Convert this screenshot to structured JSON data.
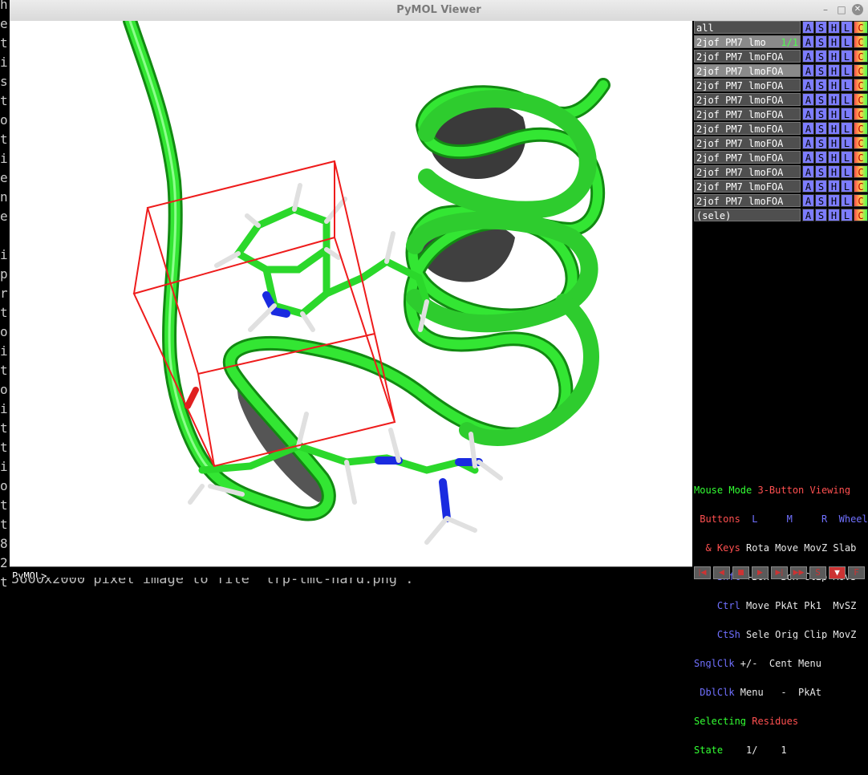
{
  "window": {
    "title": "PyMOL Viewer"
  },
  "terminal_left": [
    "h",
    "e",
    "t",
    "i",
    "s",
    "t",
    "o",
    "t",
    "i",
    "e",
    "n",
    "e",
    "",
    "i",
    "p",
    "r",
    "t",
    "o",
    "i",
    "t",
    "o",
    "i",
    "t",
    "t",
    "i",
    "o",
    "t",
    "t",
    "8",
    "2",
    "t"
  ],
  "terminal_behind": "5600x2000 pixel image to file 'trp-tmc-hard.png'.",
  "command": {
    "prompt": "PyMOL>_"
  },
  "objects": [
    {
      "name": "all",
      "state": "",
      "selected": false
    },
    {
      "name": "2jof_PM7_lmo",
      "state": "1/1",
      "selected": true
    },
    {
      "name": "2jof_PM7_lmoFOA_",
      "state": "",
      "selected": false
    },
    {
      "name": "2jof_PM7_lmoFOA_",
      "state": "",
      "selected": true
    },
    {
      "name": "2jof_PM7_lmoFOA_",
      "state": "",
      "selected": false
    },
    {
      "name": "2jof_PM7_lmoFOA_",
      "state": "",
      "selected": false
    },
    {
      "name": "2jof_PM7_lmoFOA_",
      "state": "",
      "selected": false
    },
    {
      "name": "2jof_PM7_lmoFOA_",
      "state": "",
      "selected": false
    },
    {
      "name": "2jof_PM7_lmoFOA_",
      "state": "",
      "selected": false
    },
    {
      "name": "2jof_PM7_lmoFOA_",
      "state": "",
      "selected": false
    },
    {
      "name": "2jof_PM7_lmoFOA_",
      "state": "",
      "selected": false
    },
    {
      "name": "2jof_PM7_lmoFOA_",
      "state": "",
      "selected": false
    },
    {
      "name": "2jof_PM7_lmoFOA_",
      "state": "",
      "selected": false
    },
    {
      "name": "(sele)",
      "state": "",
      "selected": false
    }
  ],
  "object_buttons": {
    "a": "A",
    "s": "S",
    "h": "H",
    "l": "L",
    "c": "C"
  },
  "mouse_mode": {
    "line1_a": "Mouse Mode ",
    "line1_b": "3-Button Viewing",
    "line2_a": " Buttons",
    "line2_b": "  L     M     R  Wheel",
    "line3_a": "  & Keys",
    "line3_b": " Rota Move MovZ Slab",
    "line4_a": "    Shft",
    "line4_b": " +Box -Box Clip MovS",
    "line5_a": "    Ctrl",
    "line5_b": " Move PkAt Pk1  MvSZ",
    "line6_a": "    CtSh",
    "line6_b": " Sele Orig Clip MovZ",
    "line7_a": "SnglClk",
    "line7_b": " +/-  Cent Menu",
    "line8_a": " DblClk",
    "line8_b": " Menu   -  PkAt",
    "line9_a": "Selecting ",
    "line9_b": "Residues",
    "line10_a": "State",
    "line10_b": "    1/    1"
  },
  "controls": [
    "|◀",
    "◀",
    "■",
    "▶",
    "▶|",
    "▶▶",
    "S",
    "▼",
    "F"
  ]
}
